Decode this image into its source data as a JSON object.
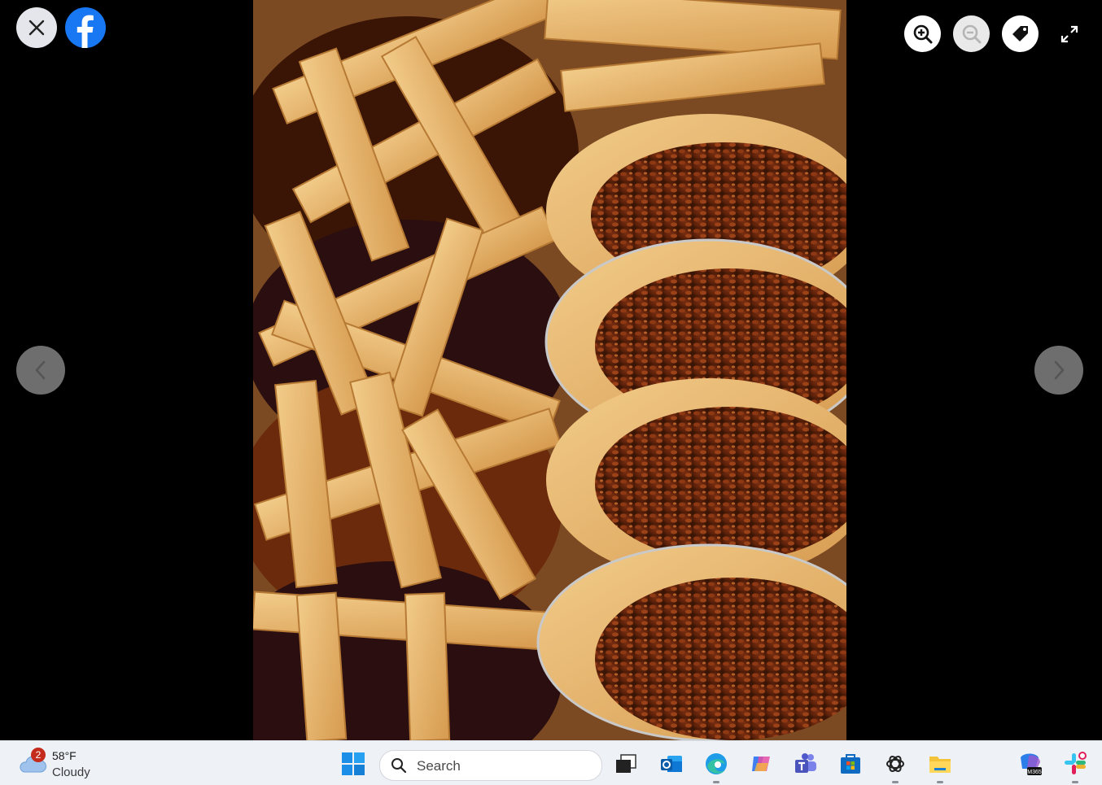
{
  "viewer": {
    "close_icon": "close-icon",
    "brand_icon": "facebook-logo-icon",
    "zoom_in_icon": "zoom-in-icon",
    "zoom_out_icon": "zoom-out-icon",
    "tag_icon": "tag-icon",
    "fullscreen_icon": "fullscreen-icon",
    "prev_icon": "chevron-left-icon",
    "next_icon": "chevron-right-icon",
    "photo_subject": "pies"
  },
  "taskbar": {
    "weather": {
      "badge": "2",
      "temp": "58°F",
      "condition": "Cloudy",
      "icon": "cloud-icon"
    },
    "search": {
      "placeholder": "Search"
    },
    "apps": [
      "windows-start-icon",
      "task-view-icon",
      "outlook-icon",
      "edge-icon",
      "copilot-icon",
      "teams-icon",
      "microsoft-store-icon",
      "chatgpt-icon",
      "file-explorer-icon",
      "m365-icon",
      "slack-icon"
    ],
    "tray_m365_label": "M365"
  },
  "colors": {
    "facebook_blue": "#1877f2",
    "taskbar_bg": "#eef1f6"
  }
}
